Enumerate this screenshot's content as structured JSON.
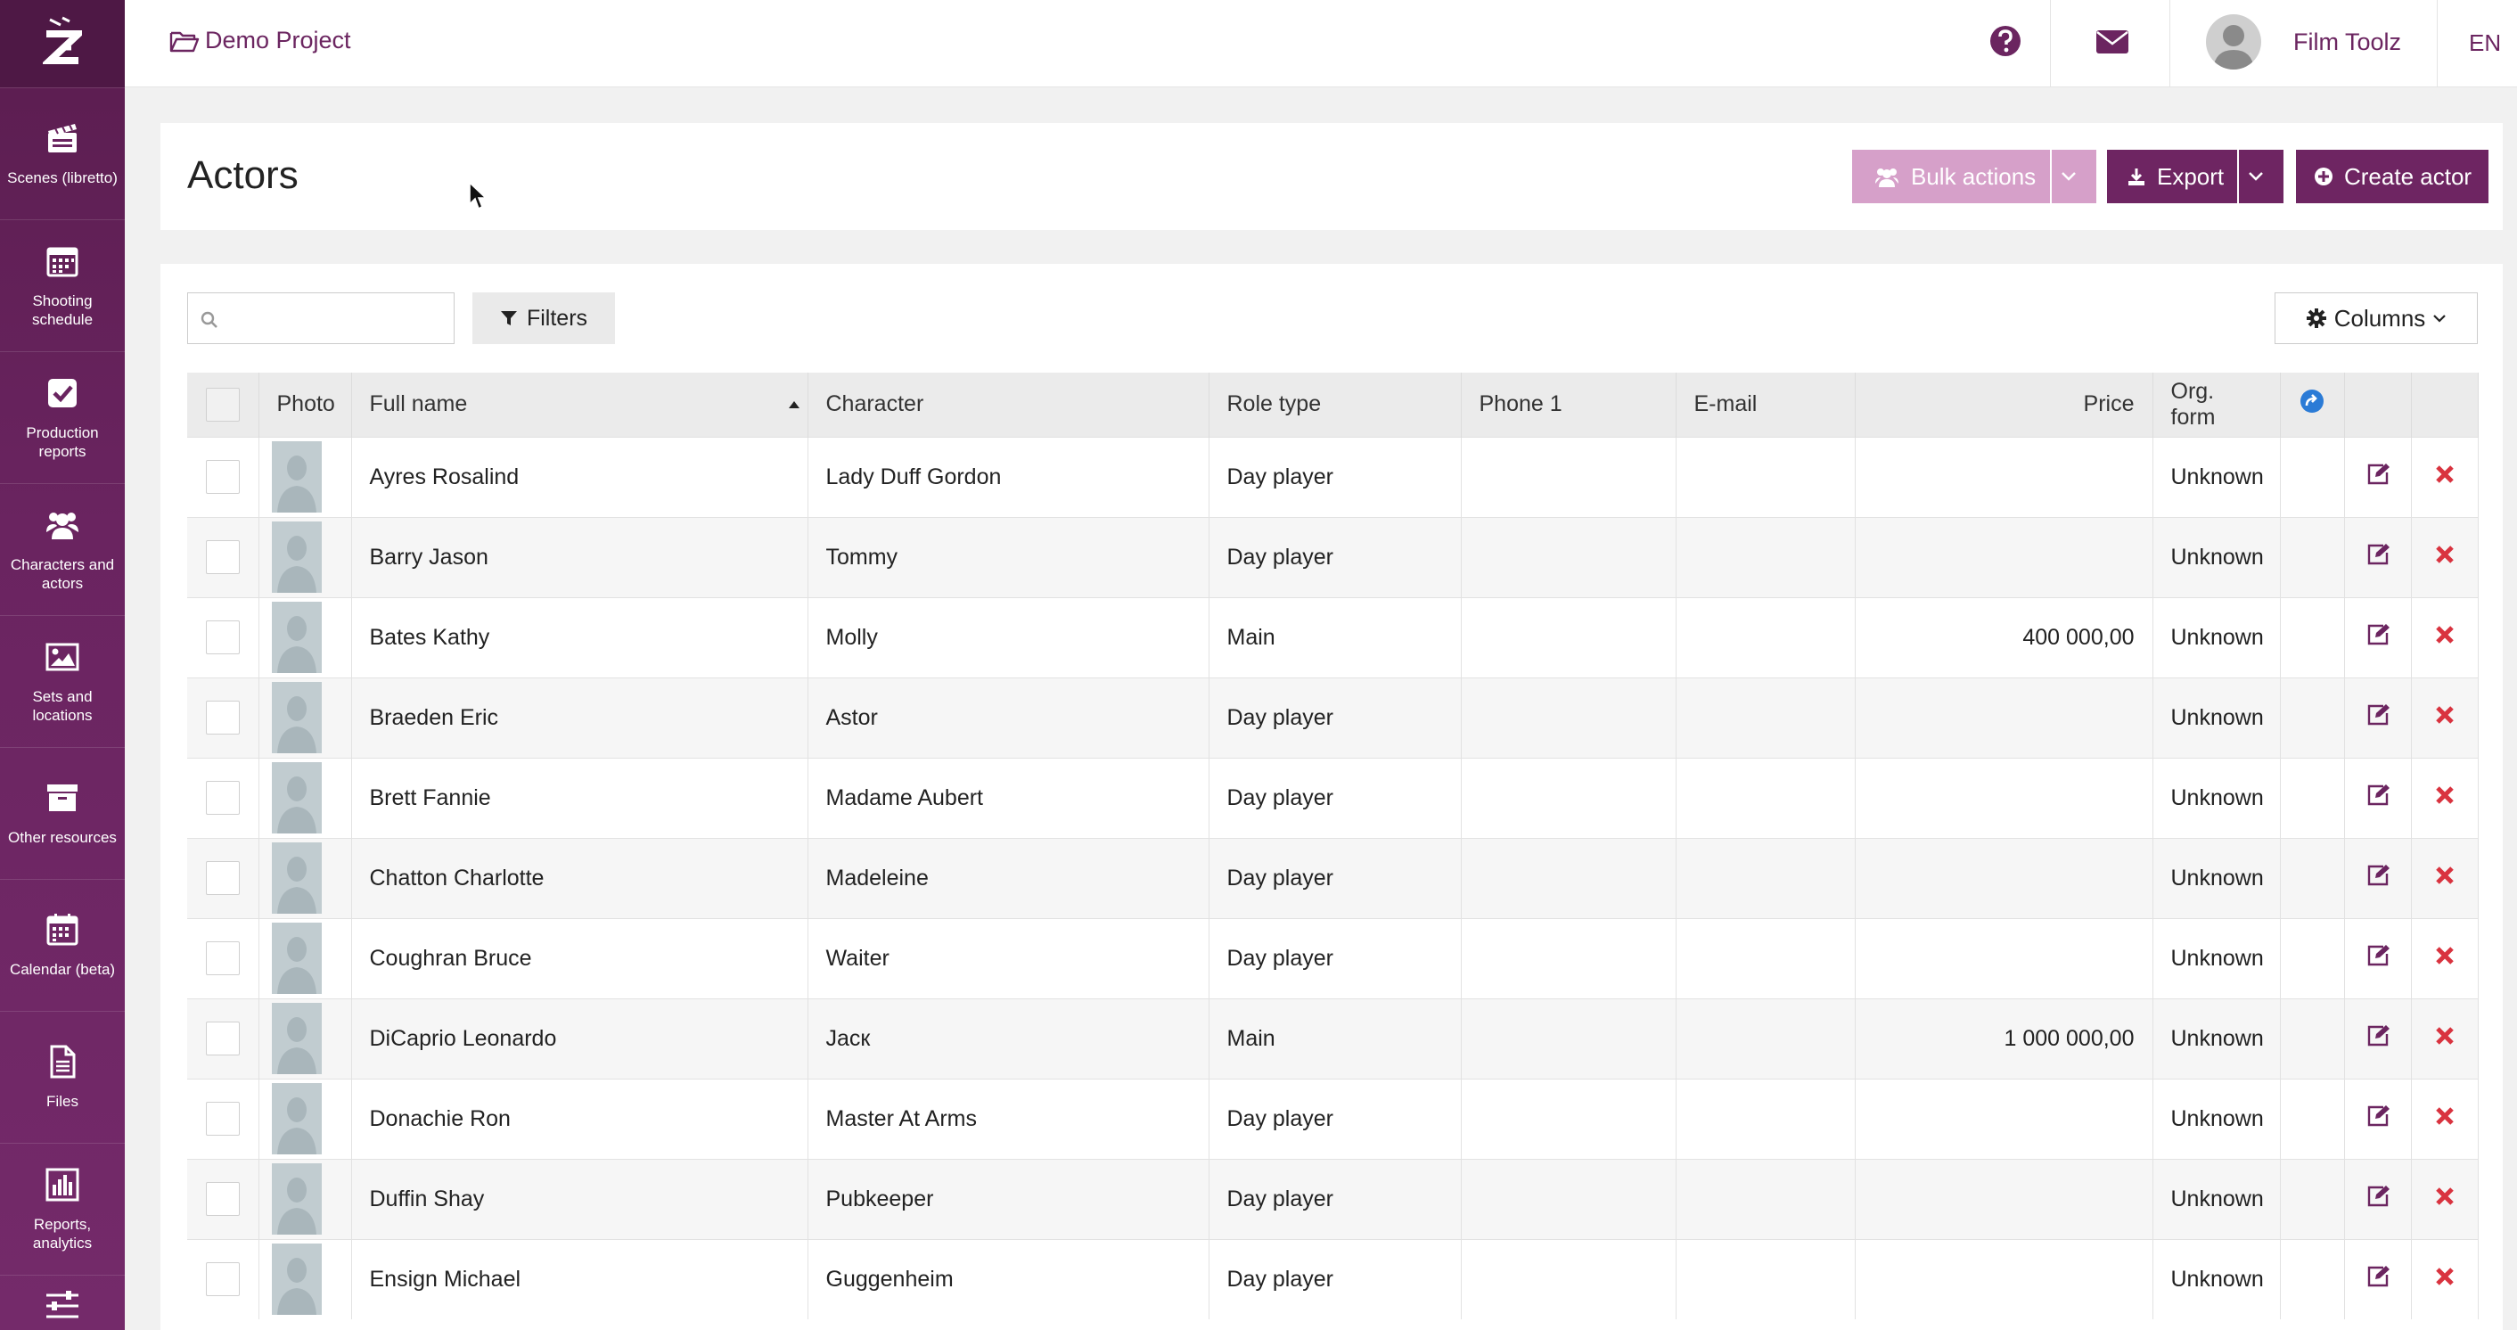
{
  "project": {
    "name": "Demo Project"
  },
  "user": {
    "name": "Film Toolz"
  },
  "language": "EN",
  "sidebar": {
    "items": [
      {
        "label": "Scenes (libretto)",
        "icon": "clapperboard-icon"
      },
      {
        "label": "Shooting schedule",
        "icon": "calendar-grid-icon"
      },
      {
        "label": "Production reports",
        "icon": "checkbox-icon"
      },
      {
        "label": "Characters and actors",
        "icon": "users-icon"
      },
      {
        "label": "Sets and locations",
        "icon": "image-icon"
      },
      {
        "label": "Other resources",
        "icon": "archive-icon"
      },
      {
        "label": "Calendar (beta)",
        "icon": "calendar-icon"
      },
      {
        "label": "Files",
        "icon": "file-icon"
      },
      {
        "label": "Reports, analytics",
        "icon": "bar-chart-icon"
      }
    ]
  },
  "page": {
    "title": "Actors"
  },
  "toolbar": {
    "bulk_label": "Bulk actions",
    "export_label": "Export",
    "create_label": "Create actor",
    "filters_label": "Filters",
    "columns_label": "Columns",
    "search_placeholder": ""
  },
  "table": {
    "headers": {
      "photo": "Photo",
      "full_name": "Full name",
      "character": "Character",
      "role_type": "Role type",
      "phone": "Phone 1",
      "email": "E-mail",
      "price": "Price",
      "org_form": "Org. form"
    },
    "rows": [
      {
        "name": "Ayres Rosalind",
        "character": "Lady Duff Gordon",
        "role": "Day player",
        "phone": "",
        "email": "",
        "price": "",
        "org": "Unknown"
      },
      {
        "name": "Barry Jason",
        "character": "Tommy",
        "role": "Day player",
        "phone": "",
        "email": "",
        "price": "",
        "org": "Unknown"
      },
      {
        "name": "Bates Kathy",
        "character": "Molly",
        "role": "Main",
        "phone": "",
        "email": "",
        "price": "400 000,00",
        "org": "Unknown"
      },
      {
        "name": "Braeden Eric",
        "character": "Astor",
        "role": "Day player",
        "phone": "",
        "email": "",
        "price": "",
        "org": "Unknown"
      },
      {
        "name": "Brett Fannie",
        "character": "Madame Aubert",
        "role": "Day player",
        "phone": "",
        "email": "",
        "price": "",
        "org": "Unknown"
      },
      {
        "name": "Chatton Charlotte",
        "character": "Madeleine",
        "role": "Day player",
        "phone": "",
        "email": "",
        "price": "",
        "org": "Unknown"
      },
      {
        "name": "Coughran Bruce",
        "character": "Waiter",
        "role": "Day player",
        "phone": "",
        "email": "",
        "price": "",
        "org": "Unknown"
      },
      {
        "name": "DiCaprio Leonardo",
        "character": "Jacк",
        "role": "Main",
        "phone": "",
        "email": "",
        "price": "1 000 000,00",
        "org": "Unknown"
      },
      {
        "name": "Donachie Ron",
        "character": "Master At Arms",
        "role": "Day player",
        "phone": "",
        "email": "",
        "price": "",
        "org": "Unknown"
      },
      {
        "name": "Duffin Shay",
        "character": "Pubkeeper",
        "role": "Day player",
        "phone": "",
        "email": "",
        "price": "",
        "org": "Unknown"
      },
      {
        "name": "Ensign Michael",
        "character": "Guggenheim",
        "role": "Day player",
        "phone": "",
        "email": "",
        "price": "",
        "org": "Unknown"
      }
    ]
  },
  "colors": {
    "brand": "#6e2562",
    "brand_light": "#d6a0c9",
    "delete": "#d9333f",
    "link_icon": "#2b7bd6"
  }
}
